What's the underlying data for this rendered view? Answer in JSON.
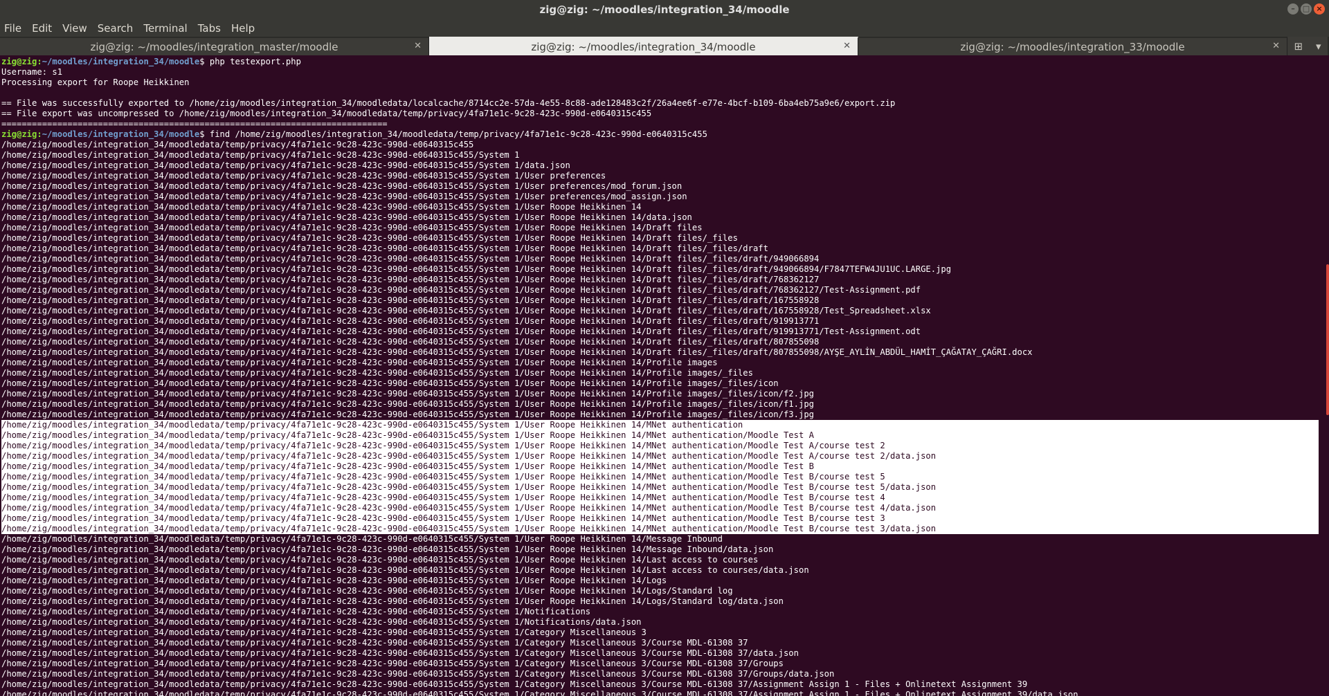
{
  "window": {
    "title": "zig@zig: ~/moodles/integration_34/moodle"
  },
  "menu": [
    "File",
    "Edit",
    "View",
    "Search",
    "Terminal",
    "Tabs",
    "Help"
  ],
  "tabs": [
    {
      "label": "zig@zig: ~/moodles/integration_master/moodle",
      "active": false
    },
    {
      "label": "zig@zig: ~/moodles/integration_34/moodle",
      "active": true
    },
    {
      "label": "zig@zig: ~/moodles/integration_33/moodle",
      "active": false
    }
  ],
  "icons": {
    "close": "close-icon",
    "new_tab": "new-tab-icon",
    "menu": "chevron-down-icon"
  },
  "colors": {
    "background": "#2e0a22",
    "prompt_user": "#8ae234",
    "prompt_path": "#729fcf",
    "selection": "#ffffff"
  },
  "terminal": {
    "lines": [
      {
        "user": "zig@zig",
        "path": "~/moodles/integration_34/moodle",
        "cmd": " php testexport.php"
      },
      {
        "text": "Username: s1"
      },
      {
        "text": "Processing export for Roope Heikkinen"
      },
      {
        "text": ""
      },
      {
        "text": "== File was successfully exported to /home/zig/moodles/integration_34/moodledata/localcache/8714cc2e-57da-4e55-8c88-ade128483c2f/26a4ee6f-e77e-4bcf-b109-6ba4eb75a9e6/export.zip"
      },
      {
        "text": "== File export was uncompressed to /home/zig/moodles/integration_34/moodledata/temp/privacy/4fa71e1c-9c28-423c-990d-e0640315c455"
      },
      {
        "text": "============================================================================"
      },
      {
        "user": "zig@zig",
        "path": "~/moodles/integration_34/moodle",
        "cmd": " find /home/zig/moodles/integration_34/moodledata/temp/privacy/4fa71e1c-9c28-423c-990d-e0640315c455"
      },
      {
        "text": "/home/zig/moodles/integration_34/moodledata/temp/privacy/4fa71e1c-9c28-423c-990d-e0640315c455"
      },
      {
        "text": "/home/zig/moodles/integration_34/moodledata/temp/privacy/4fa71e1c-9c28-423c-990d-e0640315c455/System 1"
      },
      {
        "text": "/home/zig/moodles/integration_34/moodledata/temp/privacy/4fa71e1c-9c28-423c-990d-e0640315c455/System 1/data.json"
      },
      {
        "text": "/home/zig/moodles/integration_34/moodledata/temp/privacy/4fa71e1c-9c28-423c-990d-e0640315c455/System 1/User preferences"
      },
      {
        "text": "/home/zig/moodles/integration_34/moodledata/temp/privacy/4fa71e1c-9c28-423c-990d-e0640315c455/System 1/User preferences/mod_forum.json"
      },
      {
        "text": "/home/zig/moodles/integration_34/moodledata/temp/privacy/4fa71e1c-9c28-423c-990d-e0640315c455/System 1/User preferences/mod_assign.json"
      },
      {
        "text": "/home/zig/moodles/integration_34/moodledata/temp/privacy/4fa71e1c-9c28-423c-990d-e0640315c455/System 1/User Roope Heikkinen 14"
      },
      {
        "text": "/home/zig/moodles/integration_34/moodledata/temp/privacy/4fa71e1c-9c28-423c-990d-e0640315c455/System 1/User Roope Heikkinen 14/data.json"
      },
      {
        "text": "/home/zig/moodles/integration_34/moodledata/temp/privacy/4fa71e1c-9c28-423c-990d-e0640315c455/System 1/User Roope Heikkinen 14/Draft files"
      },
      {
        "text": "/home/zig/moodles/integration_34/moodledata/temp/privacy/4fa71e1c-9c28-423c-990d-e0640315c455/System 1/User Roope Heikkinen 14/Draft files/_files"
      },
      {
        "text": "/home/zig/moodles/integration_34/moodledata/temp/privacy/4fa71e1c-9c28-423c-990d-e0640315c455/System 1/User Roope Heikkinen 14/Draft files/_files/draft"
      },
      {
        "text": "/home/zig/moodles/integration_34/moodledata/temp/privacy/4fa71e1c-9c28-423c-990d-e0640315c455/System 1/User Roope Heikkinen 14/Draft files/_files/draft/949066894"
      },
      {
        "text": "/home/zig/moodles/integration_34/moodledata/temp/privacy/4fa71e1c-9c28-423c-990d-e0640315c455/System 1/User Roope Heikkinen 14/Draft files/_files/draft/949066894/F7847TEFW4JU1UC.LARGE.jpg"
      },
      {
        "text": "/home/zig/moodles/integration_34/moodledata/temp/privacy/4fa71e1c-9c28-423c-990d-e0640315c455/System 1/User Roope Heikkinen 14/Draft files/_files/draft/768362127"
      },
      {
        "text": "/home/zig/moodles/integration_34/moodledata/temp/privacy/4fa71e1c-9c28-423c-990d-e0640315c455/System 1/User Roope Heikkinen 14/Draft files/_files/draft/768362127/Test-Assignment.pdf"
      },
      {
        "text": "/home/zig/moodles/integration_34/moodledata/temp/privacy/4fa71e1c-9c28-423c-990d-e0640315c455/System 1/User Roope Heikkinen 14/Draft files/_files/draft/167558928"
      },
      {
        "text": "/home/zig/moodles/integration_34/moodledata/temp/privacy/4fa71e1c-9c28-423c-990d-e0640315c455/System 1/User Roope Heikkinen 14/Draft files/_files/draft/167558928/Test_Spreadsheet.xlsx"
      },
      {
        "text": "/home/zig/moodles/integration_34/moodledata/temp/privacy/4fa71e1c-9c28-423c-990d-e0640315c455/System 1/User Roope Heikkinen 14/Draft files/_files/draft/919913771"
      },
      {
        "text": "/home/zig/moodles/integration_34/moodledata/temp/privacy/4fa71e1c-9c28-423c-990d-e0640315c455/System 1/User Roope Heikkinen 14/Draft files/_files/draft/919913771/Test-Assignment.odt"
      },
      {
        "text": "/home/zig/moodles/integration_34/moodledata/temp/privacy/4fa71e1c-9c28-423c-990d-e0640315c455/System 1/User Roope Heikkinen 14/Draft files/_files/draft/807855098"
      },
      {
        "text": "/home/zig/moodles/integration_34/moodledata/temp/privacy/4fa71e1c-9c28-423c-990d-e0640315c455/System 1/User Roope Heikkinen 14/Draft files/_files/draft/807855098/AYŞE_AYLİN_ABDÜL_HAMİT_ÇAĞATAY_ÇAĞRI.docx"
      },
      {
        "text": "/home/zig/moodles/integration_34/moodledata/temp/privacy/4fa71e1c-9c28-423c-990d-e0640315c455/System 1/User Roope Heikkinen 14/Profile images"
      },
      {
        "text": "/home/zig/moodles/integration_34/moodledata/temp/privacy/4fa71e1c-9c28-423c-990d-e0640315c455/System 1/User Roope Heikkinen 14/Profile images/_files"
      },
      {
        "text": "/home/zig/moodles/integration_34/moodledata/temp/privacy/4fa71e1c-9c28-423c-990d-e0640315c455/System 1/User Roope Heikkinen 14/Profile images/_files/icon"
      },
      {
        "text": "/home/zig/moodles/integration_34/moodledata/temp/privacy/4fa71e1c-9c28-423c-990d-e0640315c455/System 1/User Roope Heikkinen 14/Profile images/_files/icon/f2.jpg"
      },
      {
        "text": "/home/zig/moodles/integration_34/moodledata/temp/privacy/4fa71e1c-9c28-423c-990d-e0640315c455/System 1/User Roope Heikkinen 14/Profile images/_files/icon/f1.jpg"
      },
      {
        "text": "/home/zig/moodles/integration_34/moodledata/temp/privacy/4fa71e1c-9c28-423c-990d-e0640315c455/System 1/User Roope Heikkinen 14/Profile images/_files/icon/f3.jpg"
      },
      {
        "text": "/home/zig/moodles/integration_34/moodledata/temp/privacy/4fa71e1c-9c28-423c-990d-e0640315c455/System 1/User Roope Heikkinen 14/MNet authentication",
        "selected": true
      },
      {
        "text": "/home/zig/moodles/integration_34/moodledata/temp/privacy/4fa71e1c-9c28-423c-990d-e0640315c455/System 1/User Roope Heikkinen 14/MNet authentication/Moodle Test A",
        "selected": true
      },
      {
        "text": "/home/zig/moodles/integration_34/moodledata/temp/privacy/4fa71e1c-9c28-423c-990d-e0640315c455/System 1/User Roope Heikkinen 14/MNet authentication/Moodle Test A/course test 2",
        "selected": true
      },
      {
        "text": "/home/zig/moodles/integration_34/moodledata/temp/privacy/4fa71e1c-9c28-423c-990d-e0640315c455/System 1/User Roope Heikkinen 14/MNet authentication/Moodle Test A/course test 2/data.json",
        "selected": true
      },
      {
        "text": "/home/zig/moodles/integration_34/moodledata/temp/privacy/4fa71e1c-9c28-423c-990d-e0640315c455/System 1/User Roope Heikkinen 14/MNet authentication/Moodle Test B",
        "selected": true
      },
      {
        "text": "/home/zig/moodles/integration_34/moodledata/temp/privacy/4fa71e1c-9c28-423c-990d-e0640315c455/System 1/User Roope Heikkinen 14/MNet authentication/Moodle Test B/course test 5",
        "selected": true
      },
      {
        "text": "/home/zig/moodles/integration_34/moodledata/temp/privacy/4fa71e1c-9c28-423c-990d-e0640315c455/System 1/User Roope Heikkinen 14/MNet authentication/Moodle Test B/course test 5/data.json",
        "selected": true
      },
      {
        "text": "/home/zig/moodles/integration_34/moodledata/temp/privacy/4fa71e1c-9c28-423c-990d-e0640315c455/System 1/User Roope Heikkinen 14/MNet authentication/Moodle Test B/course test 4",
        "selected": true
      },
      {
        "text": "/home/zig/moodles/integration_34/moodledata/temp/privacy/4fa71e1c-9c28-423c-990d-e0640315c455/System 1/User Roope Heikkinen 14/MNet authentication/Moodle Test B/course test 4/data.json",
        "selected": true
      },
      {
        "text": "/home/zig/moodles/integration_34/moodledata/temp/privacy/4fa71e1c-9c28-423c-990d-e0640315c455/System 1/User Roope Heikkinen 14/MNet authentication/Moodle Test B/course test 3",
        "selected": true
      },
      {
        "text": "/home/zig/moodles/integration_34/moodledata/temp/privacy/4fa71e1c-9c28-423c-990d-e0640315c455/System 1/User Roope Heikkinen 14/MNet authentication/Moodle Test B/course test 3/data.json",
        "selected": true
      },
      {
        "text": "/home/zig/moodles/integration_34/moodledata/temp/privacy/4fa71e1c-9c28-423c-990d-e0640315c455/System 1/User Roope Heikkinen 14/Message Inbound"
      },
      {
        "text": "/home/zig/moodles/integration_34/moodledata/temp/privacy/4fa71e1c-9c28-423c-990d-e0640315c455/System 1/User Roope Heikkinen 14/Message Inbound/data.json"
      },
      {
        "text": "/home/zig/moodles/integration_34/moodledata/temp/privacy/4fa71e1c-9c28-423c-990d-e0640315c455/System 1/User Roope Heikkinen 14/Last access to courses"
      },
      {
        "text": "/home/zig/moodles/integration_34/moodledata/temp/privacy/4fa71e1c-9c28-423c-990d-e0640315c455/System 1/User Roope Heikkinen 14/Last access to courses/data.json"
      },
      {
        "text": "/home/zig/moodles/integration_34/moodledata/temp/privacy/4fa71e1c-9c28-423c-990d-e0640315c455/System 1/User Roope Heikkinen 14/Logs"
      },
      {
        "text": "/home/zig/moodles/integration_34/moodledata/temp/privacy/4fa71e1c-9c28-423c-990d-e0640315c455/System 1/User Roope Heikkinen 14/Logs/Standard log"
      },
      {
        "text": "/home/zig/moodles/integration_34/moodledata/temp/privacy/4fa71e1c-9c28-423c-990d-e0640315c455/System 1/User Roope Heikkinen 14/Logs/Standard log/data.json"
      },
      {
        "text": "/home/zig/moodles/integration_34/moodledata/temp/privacy/4fa71e1c-9c28-423c-990d-e0640315c455/System 1/Notifications"
      },
      {
        "text": "/home/zig/moodles/integration_34/moodledata/temp/privacy/4fa71e1c-9c28-423c-990d-e0640315c455/System 1/Notifications/data.json"
      },
      {
        "text": "/home/zig/moodles/integration_34/moodledata/temp/privacy/4fa71e1c-9c28-423c-990d-e0640315c455/System 1/Category Miscellaneous 3"
      },
      {
        "text": "/home/zig/moodles/integration_34/moodledata/temp/privacy/4fa71e1c-9c28-423c-990d-e0640315c455/System 1/Category Miscellaneous 3/Course MDL-61308 37"
      },
      {
        "text": "/home/zig/moodles/integration_34/moodledata/temp/privacy/4fa71e1c-9c28-423c-990d-e0640315c455/System 1/Category Miscellaneous 3/Course MDL-61308 37/data.json"
      },
      {
        "text": "/home/zig/moodles/integration_34/moodledata/temp/privacy/4fa71e1c-9c28-423c-990d-e0640315c455/System 1/Category Miscellaneous 3/Course MDL-61308 37/Groups"
      },
      {
        "text": "/home/zig/moodles/integration_34/moodledata/temp/privacy/4fa71e1c-9c28-423c-990d-e0640315c455/System 1/Category Miscellaneous 3/Course MDL-61308 37/Groups/data.json"
      },
      {
        "text": "/home/zig/moodles/integration_34/moodledata/temp/privacy/4fa71e1c-9c28-423c-990d-e0640315c455/System 1/Category Miscellaneous 3/Course MDL-61308 37/Assignment Assign 1 - Files + Onlinetext Assignment 39"
      },
      {
        "text": "/home/zig/moodles/integration_34/moodledata/temp/privacy/4fa71e1c-9c28-423c-990d-e0640315c455/System 1/Category Miscellaneous 3/Course MDL-61308 37/Assignment Assign 1 - Files + Onlinetext Assignment 39/data.json"
      }
    ]
  }
}
